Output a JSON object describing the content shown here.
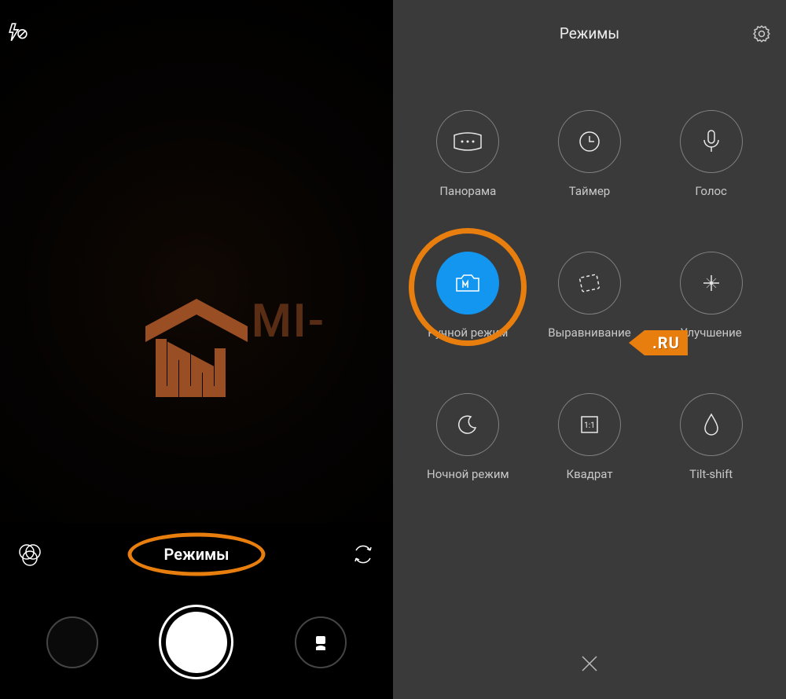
{
  "leftPane": {
    "modeLabel": "Режимы",
    "watermarkText": "MI-"
  },
  "rightPane": {
    "title": "Режимы",
    "modes": [
      {
        "label": "Панорама"
      },
      {
        "label": "Таймер"
      },
      {
        "label": "Голос"
      },
      {
        "label": "Ручной режим"
      },
      {
        "label": "Выравнивание"
      },
      {
        "label": "Улучшение"
      },
      {
        "label": "Ночной режим"
      },
      {
        "label": "Квадрат"
      },
      {
        "label": "Tilt-shift"
      }
    ],
    "badge": ".RU"
  }
}
